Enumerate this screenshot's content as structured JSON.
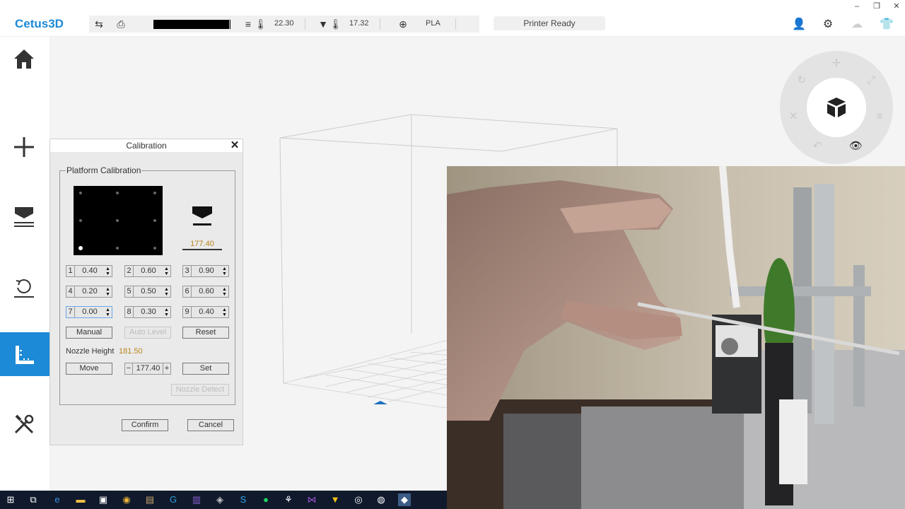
{
  "app": {
    "name": "Cetus3D",
    "status": "Printer Ready"
  },
  "window_controls": {
    "minimize": "–",
    "restore": "❐",
    "close": "✕"
  },
  "toolbar": {
    "temp1": "22.30",
    "temp2": "17.32",
    "material": "PLA"
  },
  "sidebar": {
    "items": [
      {
        "icon": "home-icon",
        "active": false
      },
      {
        "icon": "add-icon",
        "active": false
      },
      {
        "icon": "print-icon",
        "active": false
      },
      {
        "icon": "rotate-icon",
        "active": false
      },
      {
        "icon": "calibration-icon",
        "active": true
      },
      {
        "icon": "tools-icon",
        "active": false
      }
    ]
  },
  "calibration": {
    "title": "Calibration",
    "close_label": "✕",
    "group_label": "Platform Calibration",
    "nozzle_value": "177.40",
    "active_point": 7,
    "points": [
      {
        "n": "1",
        "v": "0.40"
      },
      {
        "n": "2",
        "v": "0.60"
      },
      {
        "n": "3",
        "v": "0.90"
      },
      {
        "n": "4",
        "v": "0.20"
      },
      {
        "n": "5",
        "v": "0.50"
      },
      {
        "n": "6",
        "v": "0.60"
      },
      {
        "n": "7",
        "v": "0.00"
      },
      {
        "n": "8",
        "v": "0.30"
      },
      {
        "n": "9",
        "v": "0.40"
      }
    ],
    "manual_label": "Manual",
    "auto_level_label": "Auto Level",
    "reset_label": "Reset",
    "nozzle_height_label": "Nozzle Height",
    "nozzle_height_value": "181.50",
    "move_label": "Move",
    "stepper_minus": "−",
    "stepper_value": "177.40",
    "stepper_plus": "+",
    "set_label": "Set",
    "nozzle_detect_label": "Nozzle Detect",
    "confirm_label": "Confirm",
    "cancel_label": "Cancel"
  },
  "colors": {
    "accent": "#1c8ad6",
    "value_text": "#b8861a"
  }
}
